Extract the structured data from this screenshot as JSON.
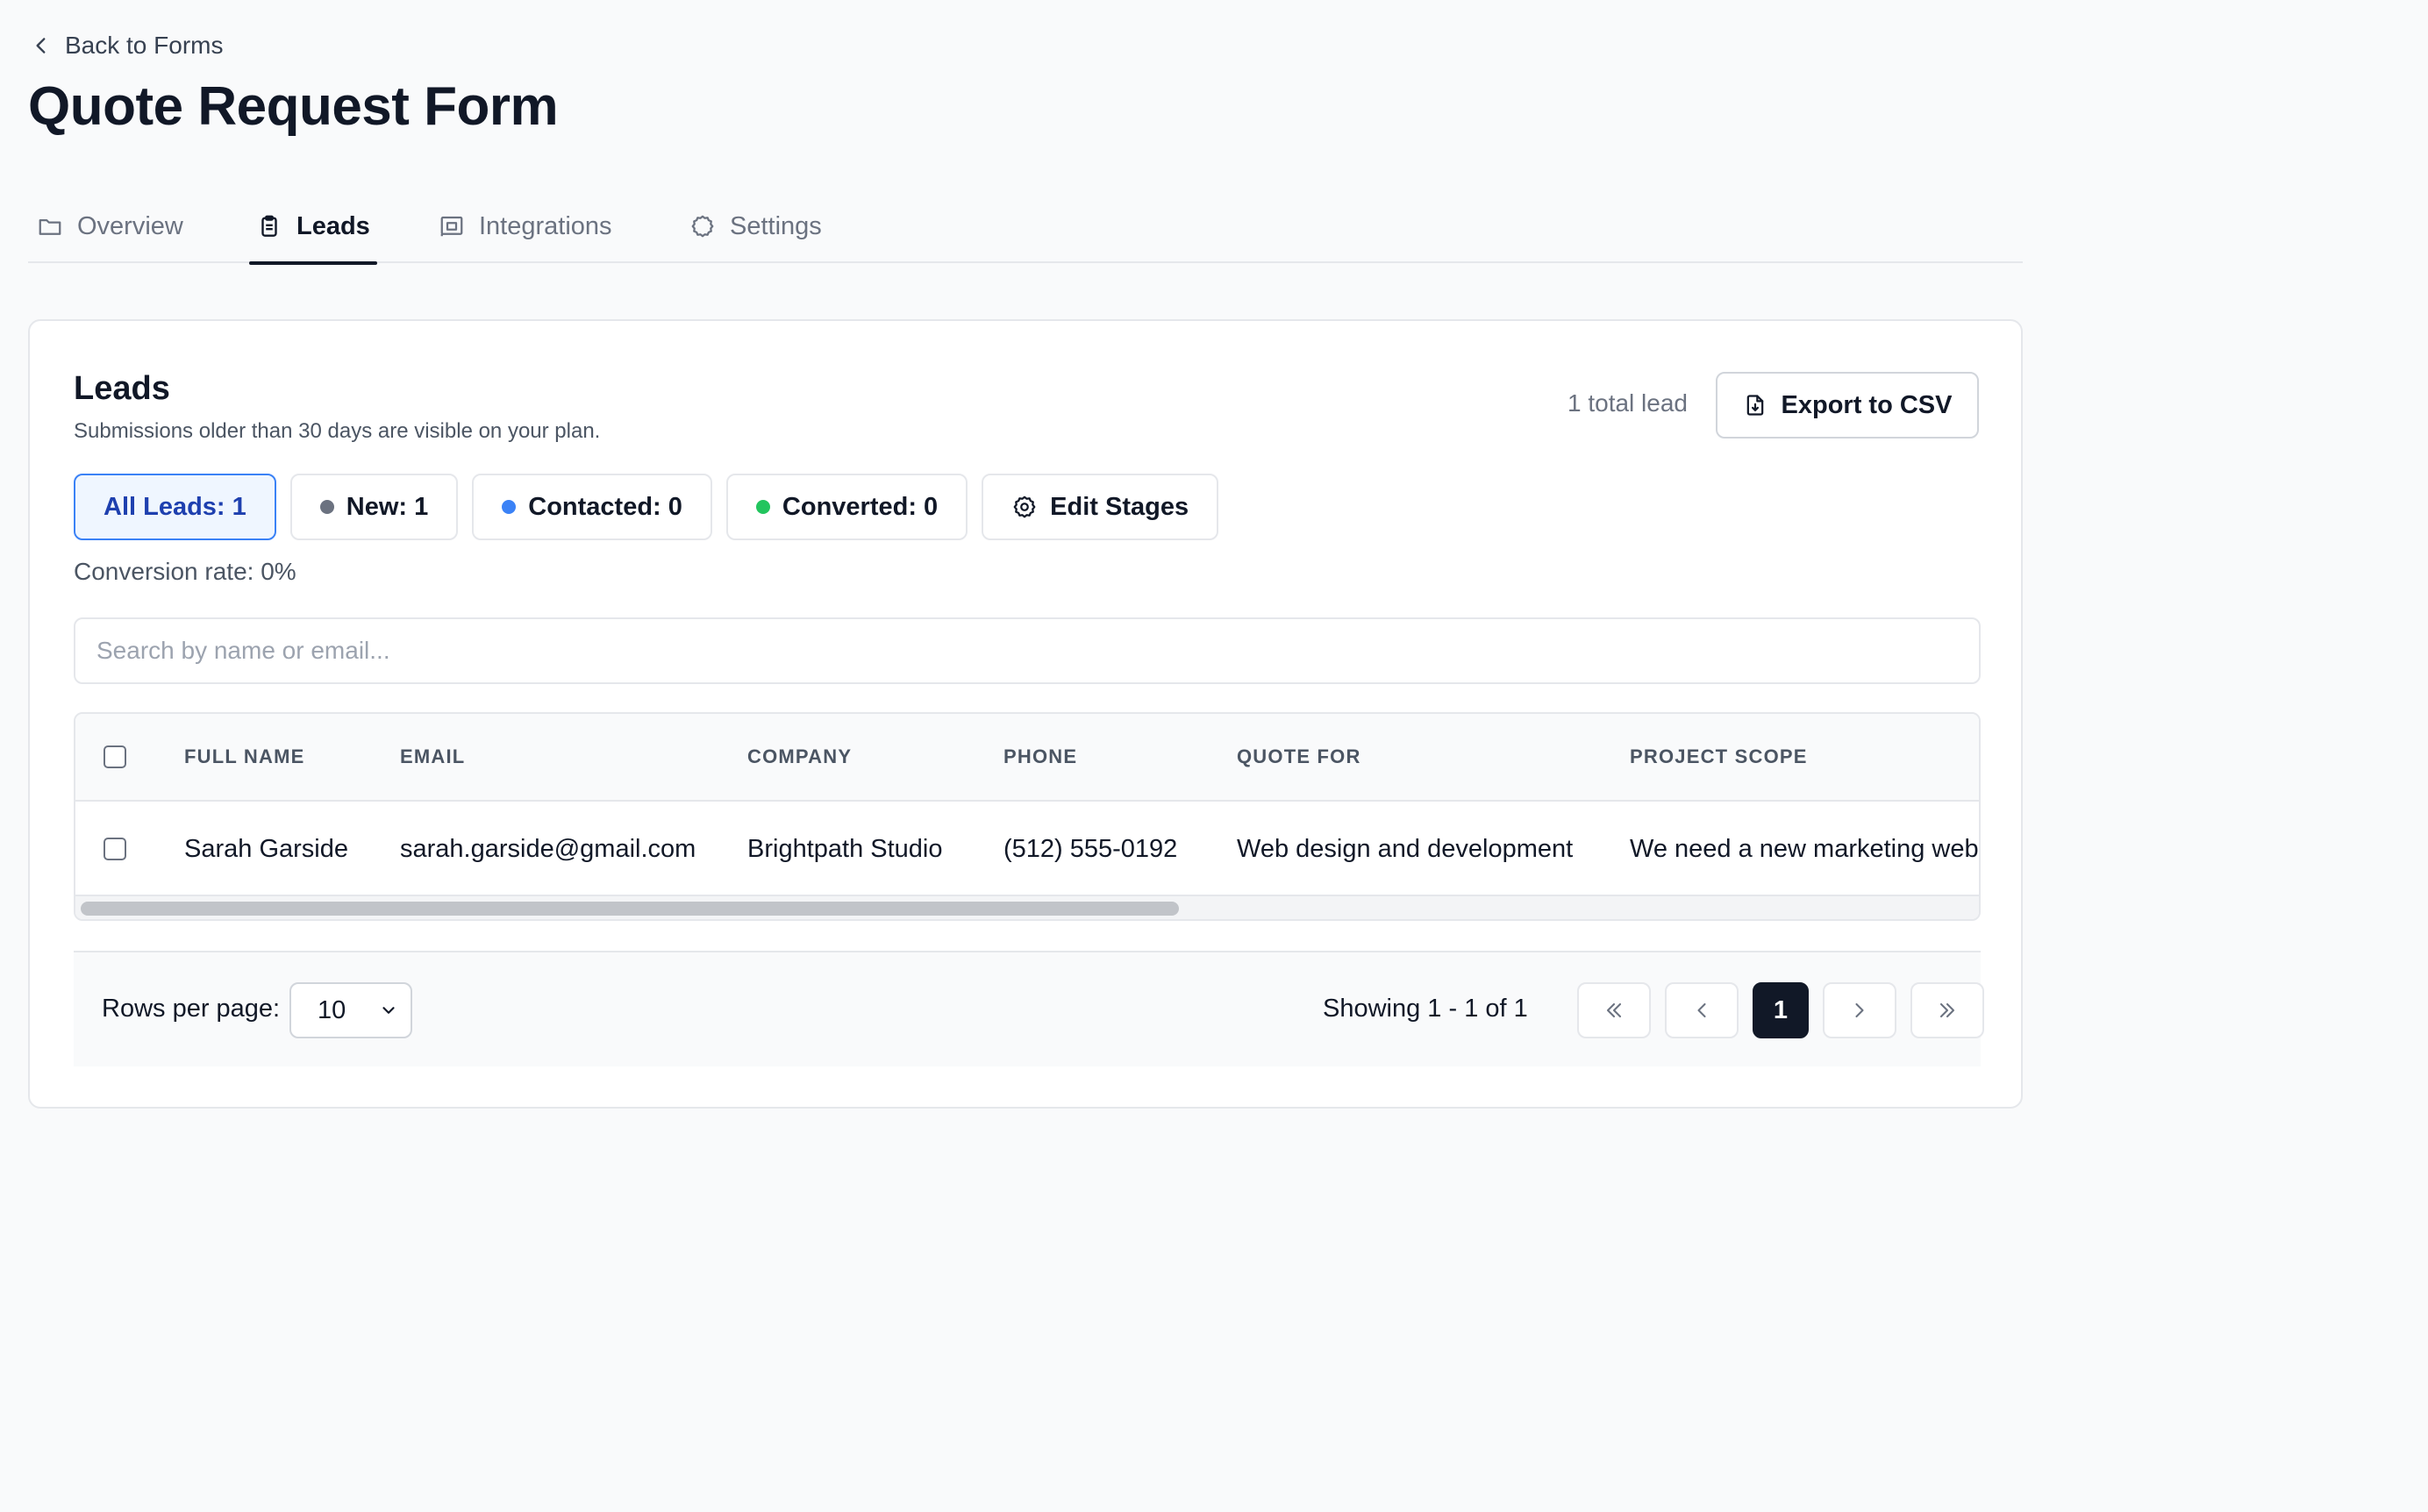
{
  "back_link": "Back to Forms",
  "page_title": "Quote Request Form",
  "tabs": [
    {
      "label": "Overview",
      "icon": "folder-icon"
    },
    {
      "label": "Leads",
      "icon": "clipboard-icon",
      "active": true
    },
    {
      "label": "Integrations",
      "icon": "integration-icon"
    },
    {
      "label": "Settings",
      "icon": "gear-icon"
    }
  ],
  "leads": {
    "title": "Leads",
    "subtitle": "Submissions older than 30 days are visible on your plan.",
    "total": "1 total lead",
    "export_label": "Export to CSV",
    "filters": {
      "all": "All Leads: 1",
      "new": "New: 1",
      "contacted": "Contacted: 0",
      "converted": "Converted: 0",
      "edit_stages": "Edit Stages"
    },
    "conversion_rate": "Conversion rate: 0%",
    "search_placeholder": "Search by name or email...",
    "stage_colors": {
      "new": "#6b7280",
      "contacted": "#3b82f6",
      "converted": "#22c55e"
    }
  },
  "table": {
    "columns": [
      "FULL NAME",
      "EMAIL",
      "COMPANY",
      "PHONE",
      "QUOTE FOR",
      "PROJECT SCOPE"
    ],
    "rows": [
      {
        "name": "Sarah Garside",
        "email": "sarah.garside@gmail.com",
        "company": "Brightpath Studio",
        "phone": "(512) 555-0192",
        "quote_for": "Web design and development",
        "project_scope": "We need a new marketing websi"
      }
    ],
    "scroll_fraction": 0.58
  },
  "pagination": {
    "rows_label": "Rows per page:",
    "rows_value": "10",
    "showing": "Showing 1 - 1 of 1",
    "current_page": "1"
  },
  "accent": "#3b82f6"
}
